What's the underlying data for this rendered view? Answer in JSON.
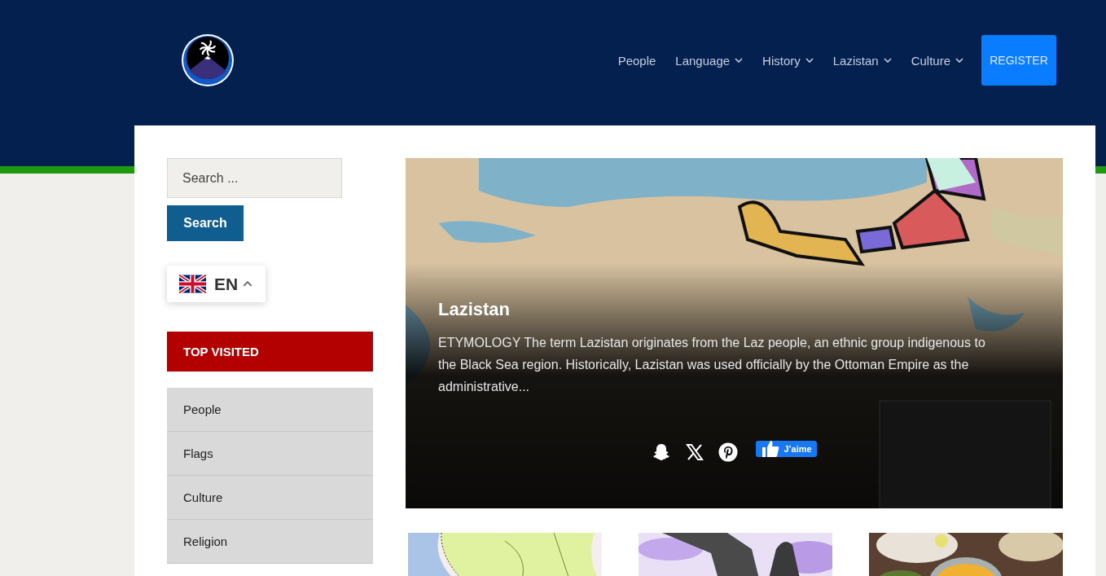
{
  "header": {
    "nav": [
      {
        "label": "People",
        "dropdown": false
      },
      {
        "label": "Language",
        "dropdown": true
      },
      {
        "label": "History",
        "dropdown": true
      },
      {
        "label": "Lazistan",
        "dropdown": true
      },
      {
        "label": "Culture",
        "dropdown": true
      }
    ],
    "register_button": "REGISTER"
  },
  "sidebar": {
    "search": {
      "placeholder": "Search ...",
      "button": "Search"
    },
    "language": {
      "code": "EN",
      "expanded": true
    },
    "top_visited": {
      "title": "TOP VISITED",
      "items": [
        "People",
        "Flags",
        "Culture",
        "Religion"
      ]
    }
  },
  "featured": {
    "title": "Lazistan",
    "excerpt": "ETYMOLOGY The term Lazistan originates from the Laz people, an ethnic group indigenous to the Black Sea region. Historically, Lazistan was used officially by the Ottoman Empire as the administrative...",
    "like_button": "J’aime"
  },
  "thumbnails": [
    {
      "kind": "map"
    },
    {
      "kind": "statue"
    },
    {
      "kind": "food"
    }
  ]
}
